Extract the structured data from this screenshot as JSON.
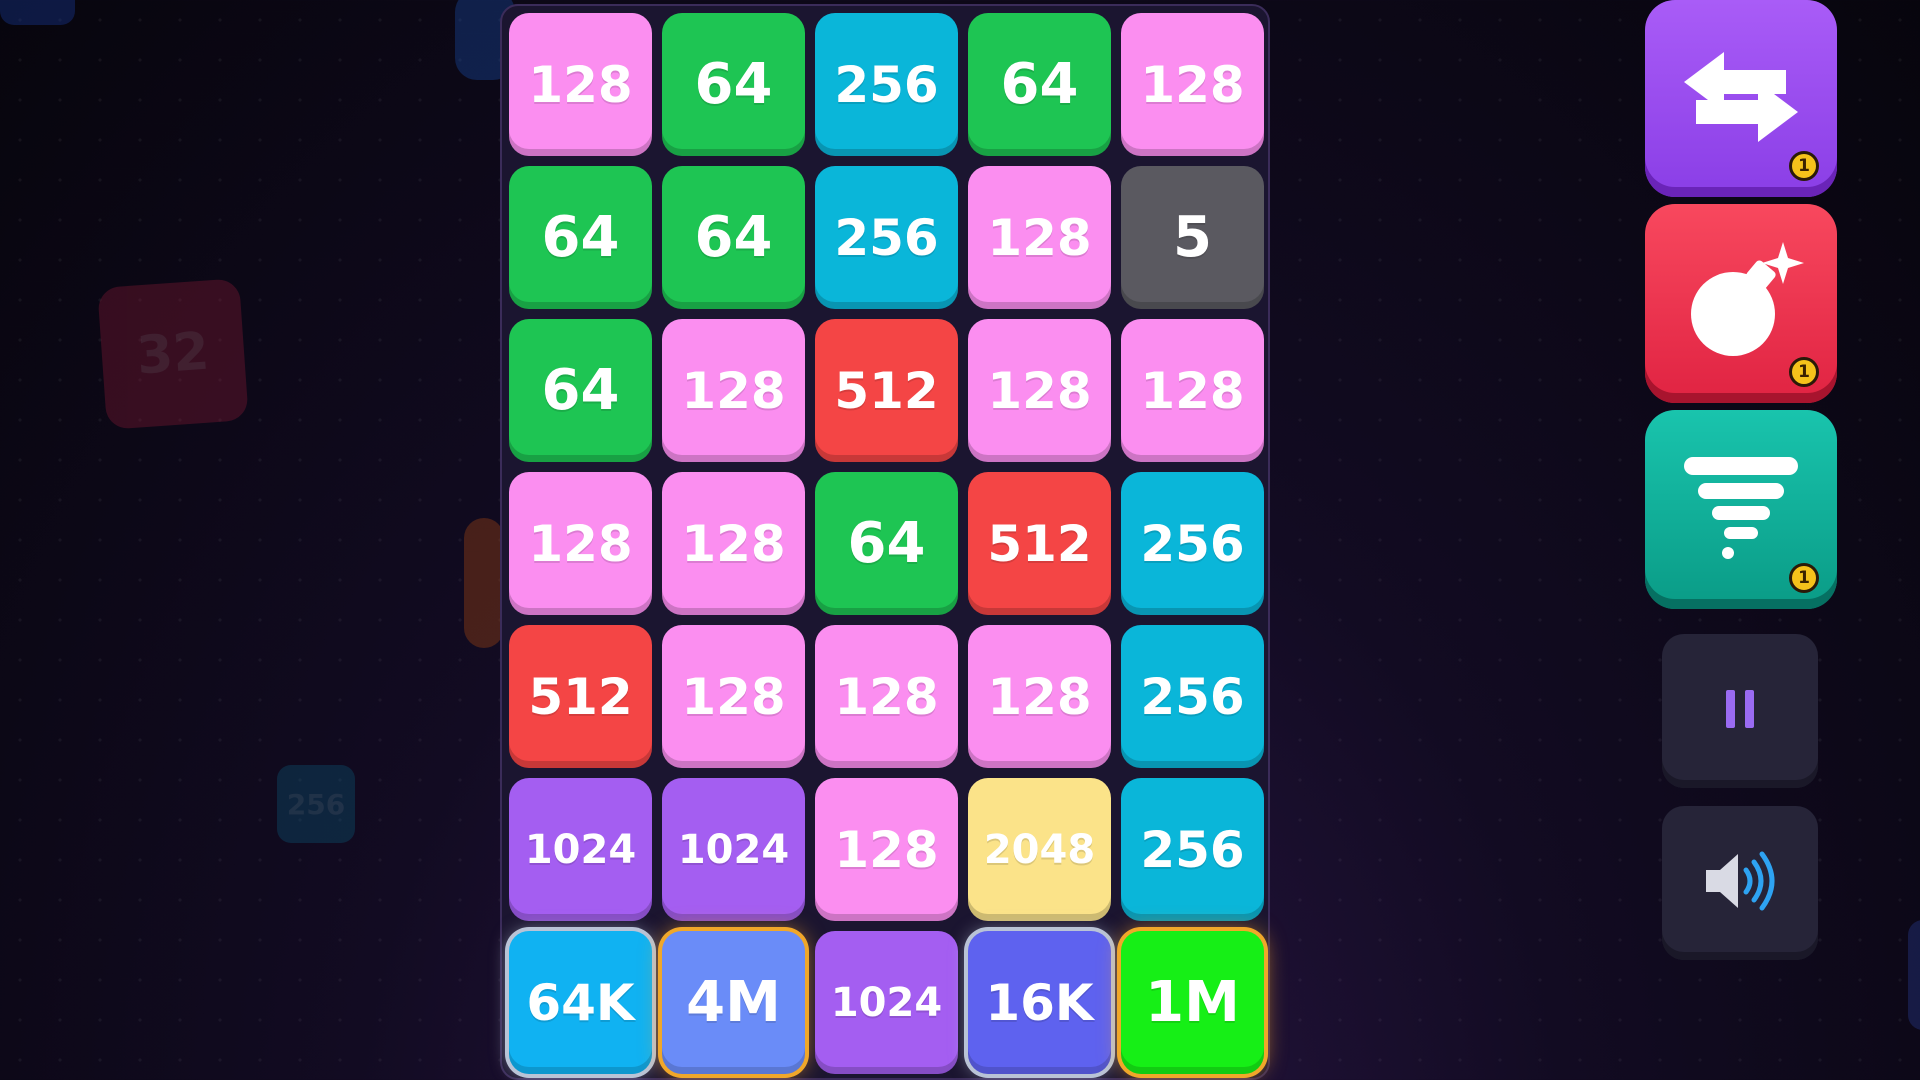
{
  "board": {
    "rows": [
      [
        {
          "v": "128",
          "c": "#fb8ef0"
        },
        {
          "v": "64",
          "c": "#1ec553"
        },
        {
          "v": "256",
          "c": "#0ab6d9"
        },
        {
          "v": "64",
          "c": "#1ec553"
        },
        {
          "v": "128",
          "c": "#fb8ef0"
        }
      ],
      [
        {
          "v": "64",
          "c": "#1ec553"
        },
        {
          "v": "64",
          "c": "#1ec553"
        },
        {
          "v": "256",
          "c": "#0ab6d9"
        },
        {
          "v": "128",
          "c": "#fb8ef0"
        },
        {
          "v": "5",
          "c": "#5a5960"
        }
      ],
      [
        {
          "v": "64",
          "c": "#1ec553"
        },
        {
          "v": "128",
          "c": "#fb8ef0"
        },
        {
          "v": "512",
          "c": "#f44545"
        },
        {
          "v": "128",
          "c": "#fb8ef0"
        },
        {
          "v": "128",
          "c": "#fb8ef0"
        }
      ],
      [
        {
          "v": "128",
          "c": "#fb8ef0"
        },
        {
          "v": "128",
          "c": "#fb8ef0"
        },
        {
          "v": "64",
          "c": "#1ec553"
        },
        {
          "v": "512",
          "c": "#f44545"
        },
        {
          "v": "256",
          "c": "#0ab6d9"
        }
      ],
      [
        {
          "v": "512",
          "c": "#f44545"
        },
        {
          "v": "128",
          "c": "#fb8ef0"
        },
        {
          "v": "128",
          "c": "#fb8ef0"
        },
        {
          "v": "128",
          "c": "#fb8ef0"
        },
        {
          "v": "256",
          "c": "#0ab6d9"
        }
      ],
      [
        {
          "v": "1024",
          "c": "#a45ef1"
        },
        {
          "v": "1024",
          "c": "#a45ef1"
        },
        {
          "v": "128",
          "c": "#fb8ef0"
        },
        {
          "v": "2048",
          "c": "#fbe389"
        },
        {
          "v": "256",
          "c": "#0ab6d9"
        }
      ],
      [
        {
          "v": "64K",
          "c": "#10b2f2",
          "glow": "silver"
        },
        {
          "v": "4M",
          "c": "#6a8cf8",
          "glow": "gold"
        },
        {
          "v": "1024",
          "c": "#a45ef1"
        },
        {
          "v": "16K",
          "c": "#5e62ef",
          "glow": "silver"
        },
        {
          "v": "1M",
          "c": "#16ef16",
          "glow": "gold"
        }
      ]
    ]
  },
  "background_tiles": [
    "32",
    "256"
  ],
  "powerups": [
    {
      "name": "swap",
      "icon": "swap-arrows-icon",
      "count": "1",
      "color": "#9848f0"
    },
    {
      "name": "bomb",
      "icon": "bomb-icon",
      "count": "1",
      "color": "#f2314c"
    },
    {
      "name": "tornado",
      "icon": "tornado-icon",
      "count": "1",
      "color": "#0fb09a"
    }
  ],
  "controls": [
    {
      "name": "pause",
      "icon": "pause-icon"
    },
    {
      "name": "sound",
      "icon": "speaker-icon"
    }
  ]
}
